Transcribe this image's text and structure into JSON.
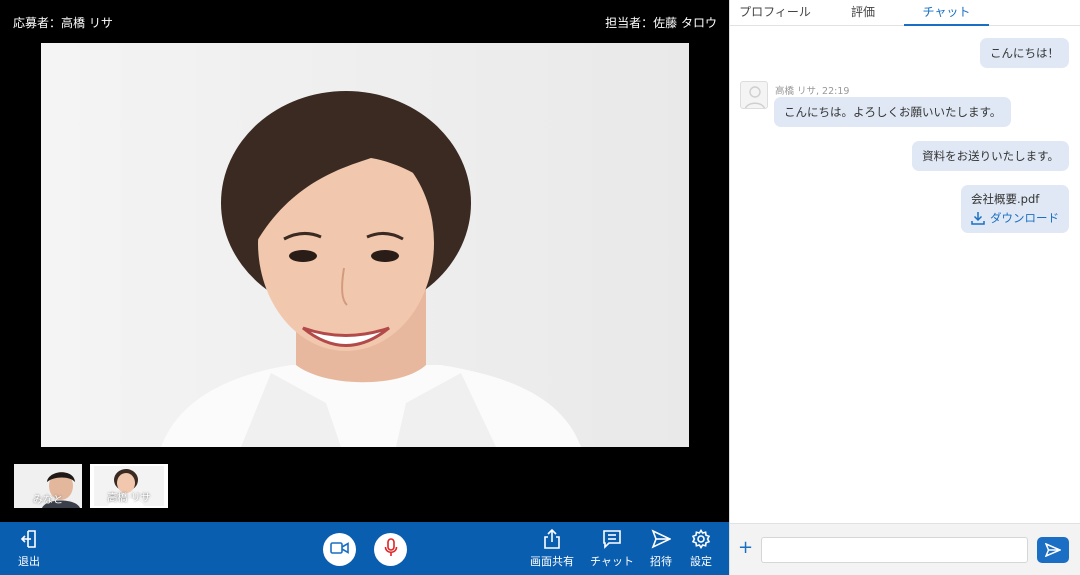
{
  "header": {
    "applicant": "応募者：高橋 リサ",
    "staff": "担当者：佐藤 タロウ"
  },
  "thumbnails": [
    {
      "name": "みなと"
    },
    {
      "name": "高橋 リサ"
    }
  ],
  "toolbar": {
    "exit_label": "退出",
    "screen_share_label": "画面共有",
    "chat_label": "チャット",
    "invite_label": "招待",
    "settings_label": "設定",
    "camera_icon": "video-camera-icon",
    "mic_icon": "microphone-icon",
    "mic_color": "#e02424"
  },
  "tabs": [
    {
      "label": "プロフィール",
      "active": false
    },
    {
      "label": "評価",
      "active": false
    },
    {
      "label": "チャット",
      "active": true
    }
  ],
  "chat": {
    "messages": [
      {
        "from": "self",
        "text": "こんにちは！"
      },
      {
        "from": "other",
        "sender": "高橋 リサ, 22:19",
        "text": "こんにちは。よろしくお願いいたします。"
      },
      {
        "from": "self",
        "text": "資料をお送りいたします。"
      },
      {
        "from": "self",
        "file": "会社概要.pdf",
        "download_label": "ダウンロード"
      }
    ],
    "input_placeholder": "",
    "add_symbol": "+"
  },
  "colors": {
    "toolbar": "#0a5eb0",
    "accent": "#1a6fc4",
    "bubble": "#dfe8f4"
  }
}
